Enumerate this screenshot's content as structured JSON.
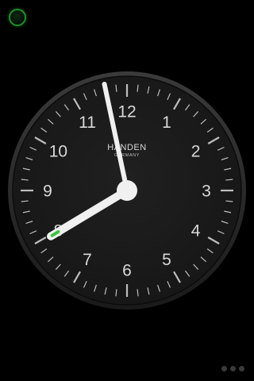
{
  "clock": {
    "brand": "HANDEN",
    "brand_sub": "GERMANY",
    "numerals": [
      "12",
      "1",
      "2",
      "3",
      "4",
      "5",
      "6",
      "7",
      "8",
      "9",
      "10",
      "11"
    ],
    "time": {
      "hour": 7,
      "minute": 58
    },
    "colors": {
      "face": "#1b1b1b",
      "bezel": "#2a2a2a",
      "hands": "#f0f0f0",
      "ticks": "#bdbdbd",
      "second_hand": "#3cc43c"
    }
  },
  "status_indicator": {
    "color": "#1f8f2a"
  },
  "pager": {
    "count": 3,
    "active_index": 0
  }
}
